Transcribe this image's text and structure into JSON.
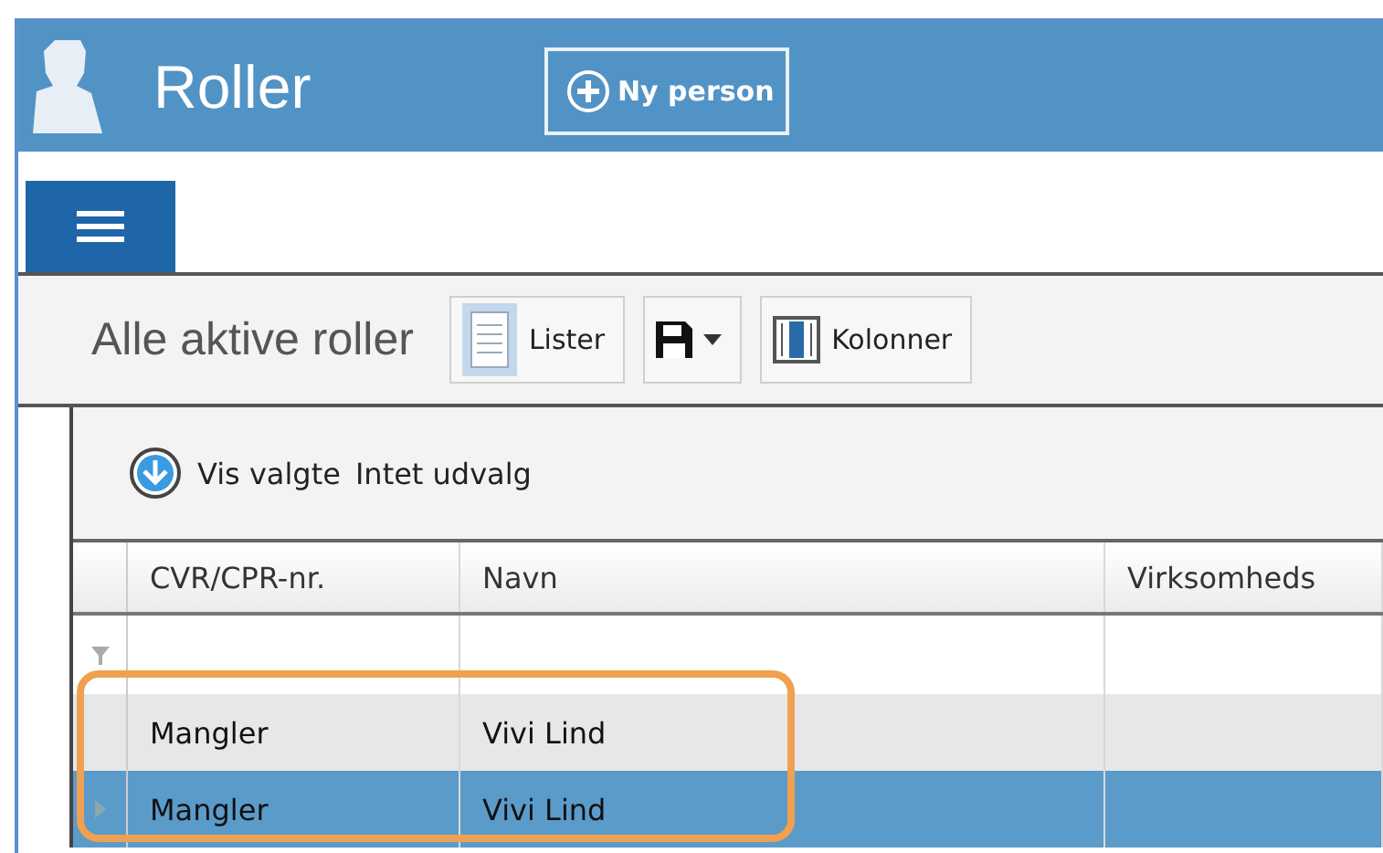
{
  "header": {
    "title": "Roller",
    "new_button": "Ny person"
  },
  "menu_tab": {
    "selected": true
  },
  "toolbar": {
    "title": "Alle aktive roller",
    "buttons": [
      {
        "kind": "list",
        "label": "Lister"
      },
      {
        "kind": "save"
      },
      {
        "kind": "columns",
        "label": "Kolonner"
      }
    ]
  },
  "filter_bar": {
    "show_selected": "Vis valgte",
    "selection": "Intet udvalg"
  },
  "table": {
    "columns": [
      "CVR/CPR-nr.",
      "Navn",
      "Virksomheds"
    ],
    "rows": [
      {
        "cells": [
          "Mangler",
          "Vivi Lind"
        ],
        "selected": false
      },
      {
        "cells": [
          "Mangler",
          "Vivi Lind"
        ],
        "selected": true
      }
    ]
  },
  "highlight": {
    "visible": true
  }
}
